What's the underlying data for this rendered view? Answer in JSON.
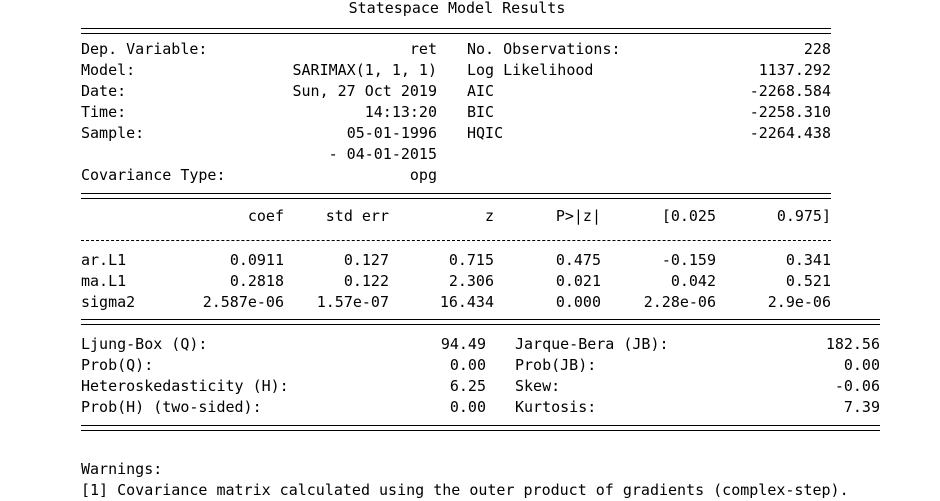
{
  "title": "Statespace Model Results",
  "summary": {
    "left": [
      {
        "label": "Dep. Variable:",
        "value": "ret"
      },
      {
        "label": "Model:",
        "value": "SARIMAX(1, 1, 1)"
      },
      {
        "label": "Date:",
        "value": "Sun, 27 Oct 2019"
      },
      {
        "label": "Time:",
        "value": "14:13:20"
      },
      {
        "label": "Sample:",
        "value": "05-01-1996"
      },
      {
        "label": "",
        "value": "- 04-01-2015"
      },
      {
        "label": "Covariance Type:",
        "value": "opg"
      }
    ],
    "right": [
      {
        "label": "No. Observations:",
        "value": "228"
      },
      {
        "label": "Log Likelihood",
        "value": "1137.292"
      },
      {
        "label": "AIC",
        "value": "-2268.584"
      },
      {
        "label": "BIC",
        "value": "-2258.310"
      },
      {
        "label": "HQIC",
        "value": "-2264.438"
      }
    ]
  },
  "coef_table": {
    "headers": [
      "coef",
      "std err",
      "z",
      "P>|z|",
      "[0.025",
      "0.975]"
    ],
    "rows": [
      {
        "name": "ar.L1",
        "values": [
          "0.0911",
          "0.127",
          "0.715",
          "0.475",
          "-0.159",
          "0.341"
        ]
      },
      {
        "name": "ma.L1",
        "values": [
          "0.2818",
          "0.122",
          "2.306",
          "0.021",
          "0.042",
          "0.521"
        ]
      },
      {
        "name": "sigma2",
        "values": [
          "2.587e-06",
          "1.57e-07",
          "16.434",
          "0.000",
          "2.28e-06",
          "2.9e-06"
        ]
      }
    ]
  },
  "diagnostics": {
    "left": [
      {
        "label": "Ljung-Box (Q):",
        "value": "94.49"
      },
      {
        "label": "Prob(Q):",
        "value": "0.00"
      },
      {
        "label": "Heteroskedasticity (H):",
        "value": "6.25"
      },
      {
        "label": "Prob(H) (two-sided):",
        "value": "0.00"
      }
    ],
    "right": [
      {
        "label": "Jarque-Bera (JB):",
        "value": "182.56"
      },
      {
        "label": "Prob(JB):",
        "value": "0.00"
      },
      {
        "label": "Skew:",
        "value": "-0.06"
      },
      {
        "label": "Kurtosis:",
        "value": "7.39"
      }
    ]
  },
  "warnings": {
    "heading": "Warnings:",
    "items": [
      "[1] Covariance matrix calculated using the outer product of gradients (complex-step)."
    ]
  }
}
